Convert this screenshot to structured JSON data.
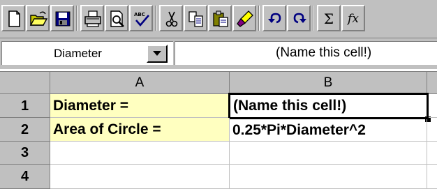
{
  "toolbar": {
    "buttons": [
      {
        "name": "new-icon"
      },
      {
        "name": "open-icon"
      },
      {
        "name": "save-icon"
      },
      {
        "name": "print-icon"
      },
      {
        "name": "print-preview-icon"
      },
      {
        "name": "spelling-icon"
      },
      {
        "name": "cut-icon"
      },
      {
        "name": "copy-icon"
      },
      {
        "name": "paste-icon"
      },
      {
        "name": "format-painter-icon"
      },
      {
        "name": "undo-icon"
      },
      {
        "name": "redo-icon"
      },
      {
        "name": "autosum-icon"
      },
      {
        "name": "function-icon"
      }
    ],
    "sigma": "Σ",
    "fx": "fx"
  },
  "name_box": {
    "value": "Diameter"
  },
  "formula_bar": {
    "value": "(Name this cell!)"
  },
  "sheet": {
    "columns": [
      "A",
      "B"
    ],
    "rows": [
      {
        "number": "1",
        "cells": [
          "Diameter =",
          "(Name this cell!)"
        ]
      },
      {
        "number": "2",
        "cells": [
          "Area of Circle =",
          "0.25*Pi*Diameter^2"
        ]
      },
      {
        "number": "3",
        "cells": [
          "",
          ""
        ]
      },
      {
        "number": "4",
        "cells": [
          "",
          ""
        ]
      }
    ]
  },
  "colors": {
    "label_fill": "#ffffc0",
    "chrome": "#c0c0c0"
  }
}
